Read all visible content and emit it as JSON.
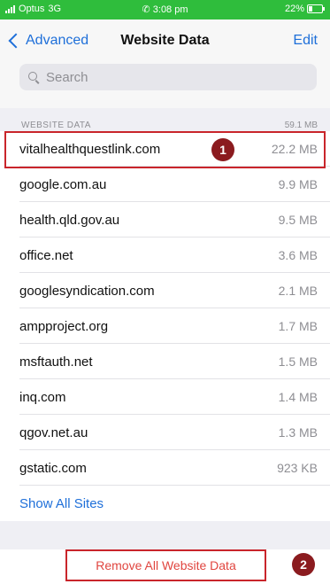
{
  "status_bar": {
    "carrier": "Optus",
    "network": "3G",
    "time": "3:08 pm",
    "battery": "22%"
  },
  "nav": {
    "back_label": "Advanced",
    "title": "Website Data",
    "edit_label": "Edit"
  },
  "search": {
    "placeholder": "Search"
  },
  "section": {
    "label": "WEBSITE DATA",
    "total": "59.1 MB"
  },
  "sites": [
    {
      "domain": "vitalhealthquestlink.com",
      "size": "22.2 MB"
    },
    {
      "domain": "google.com.au",
      "size": "9.9 MB"
    },
    {
      "domain": "health.qld.gov.au",
      "size": "9.5 MB"
    },
    {
      "domain": "office.net",
      "size": "3.6 MB"
    },
    {
      "domain": "googlesyndication.com",
      "size": "2.1 MB"
    },
    {
      "domain": "ampproject.org",
      "size": "1.7 MB"
    },
    {
      "domain": "msftauth.net",
      "size": "1.5 MB"
    },
    {
      "domain": "inq.com",
      "size": "1.4 MB"
    },
    {
      "domain": "qgov.net.au",
      "size": "1.3 MB"
    },
    {
      "domain": "gstatic.com",
      "size": "923 KB"
    }
  ],
  "show_all_label": "Show All Sites",
  "remove_label": "Remove All Website Data",
  "annotations": {
    "step1": "1",
    "step2": "2"
  },
  "colors": {
    "status_green": "#2fbd3c",
    "ios_blue": "#1e6fd9",
    "highlight_red": "#c9252b",
    "badge_dark_red": "#8b1b1f"
  }
}
